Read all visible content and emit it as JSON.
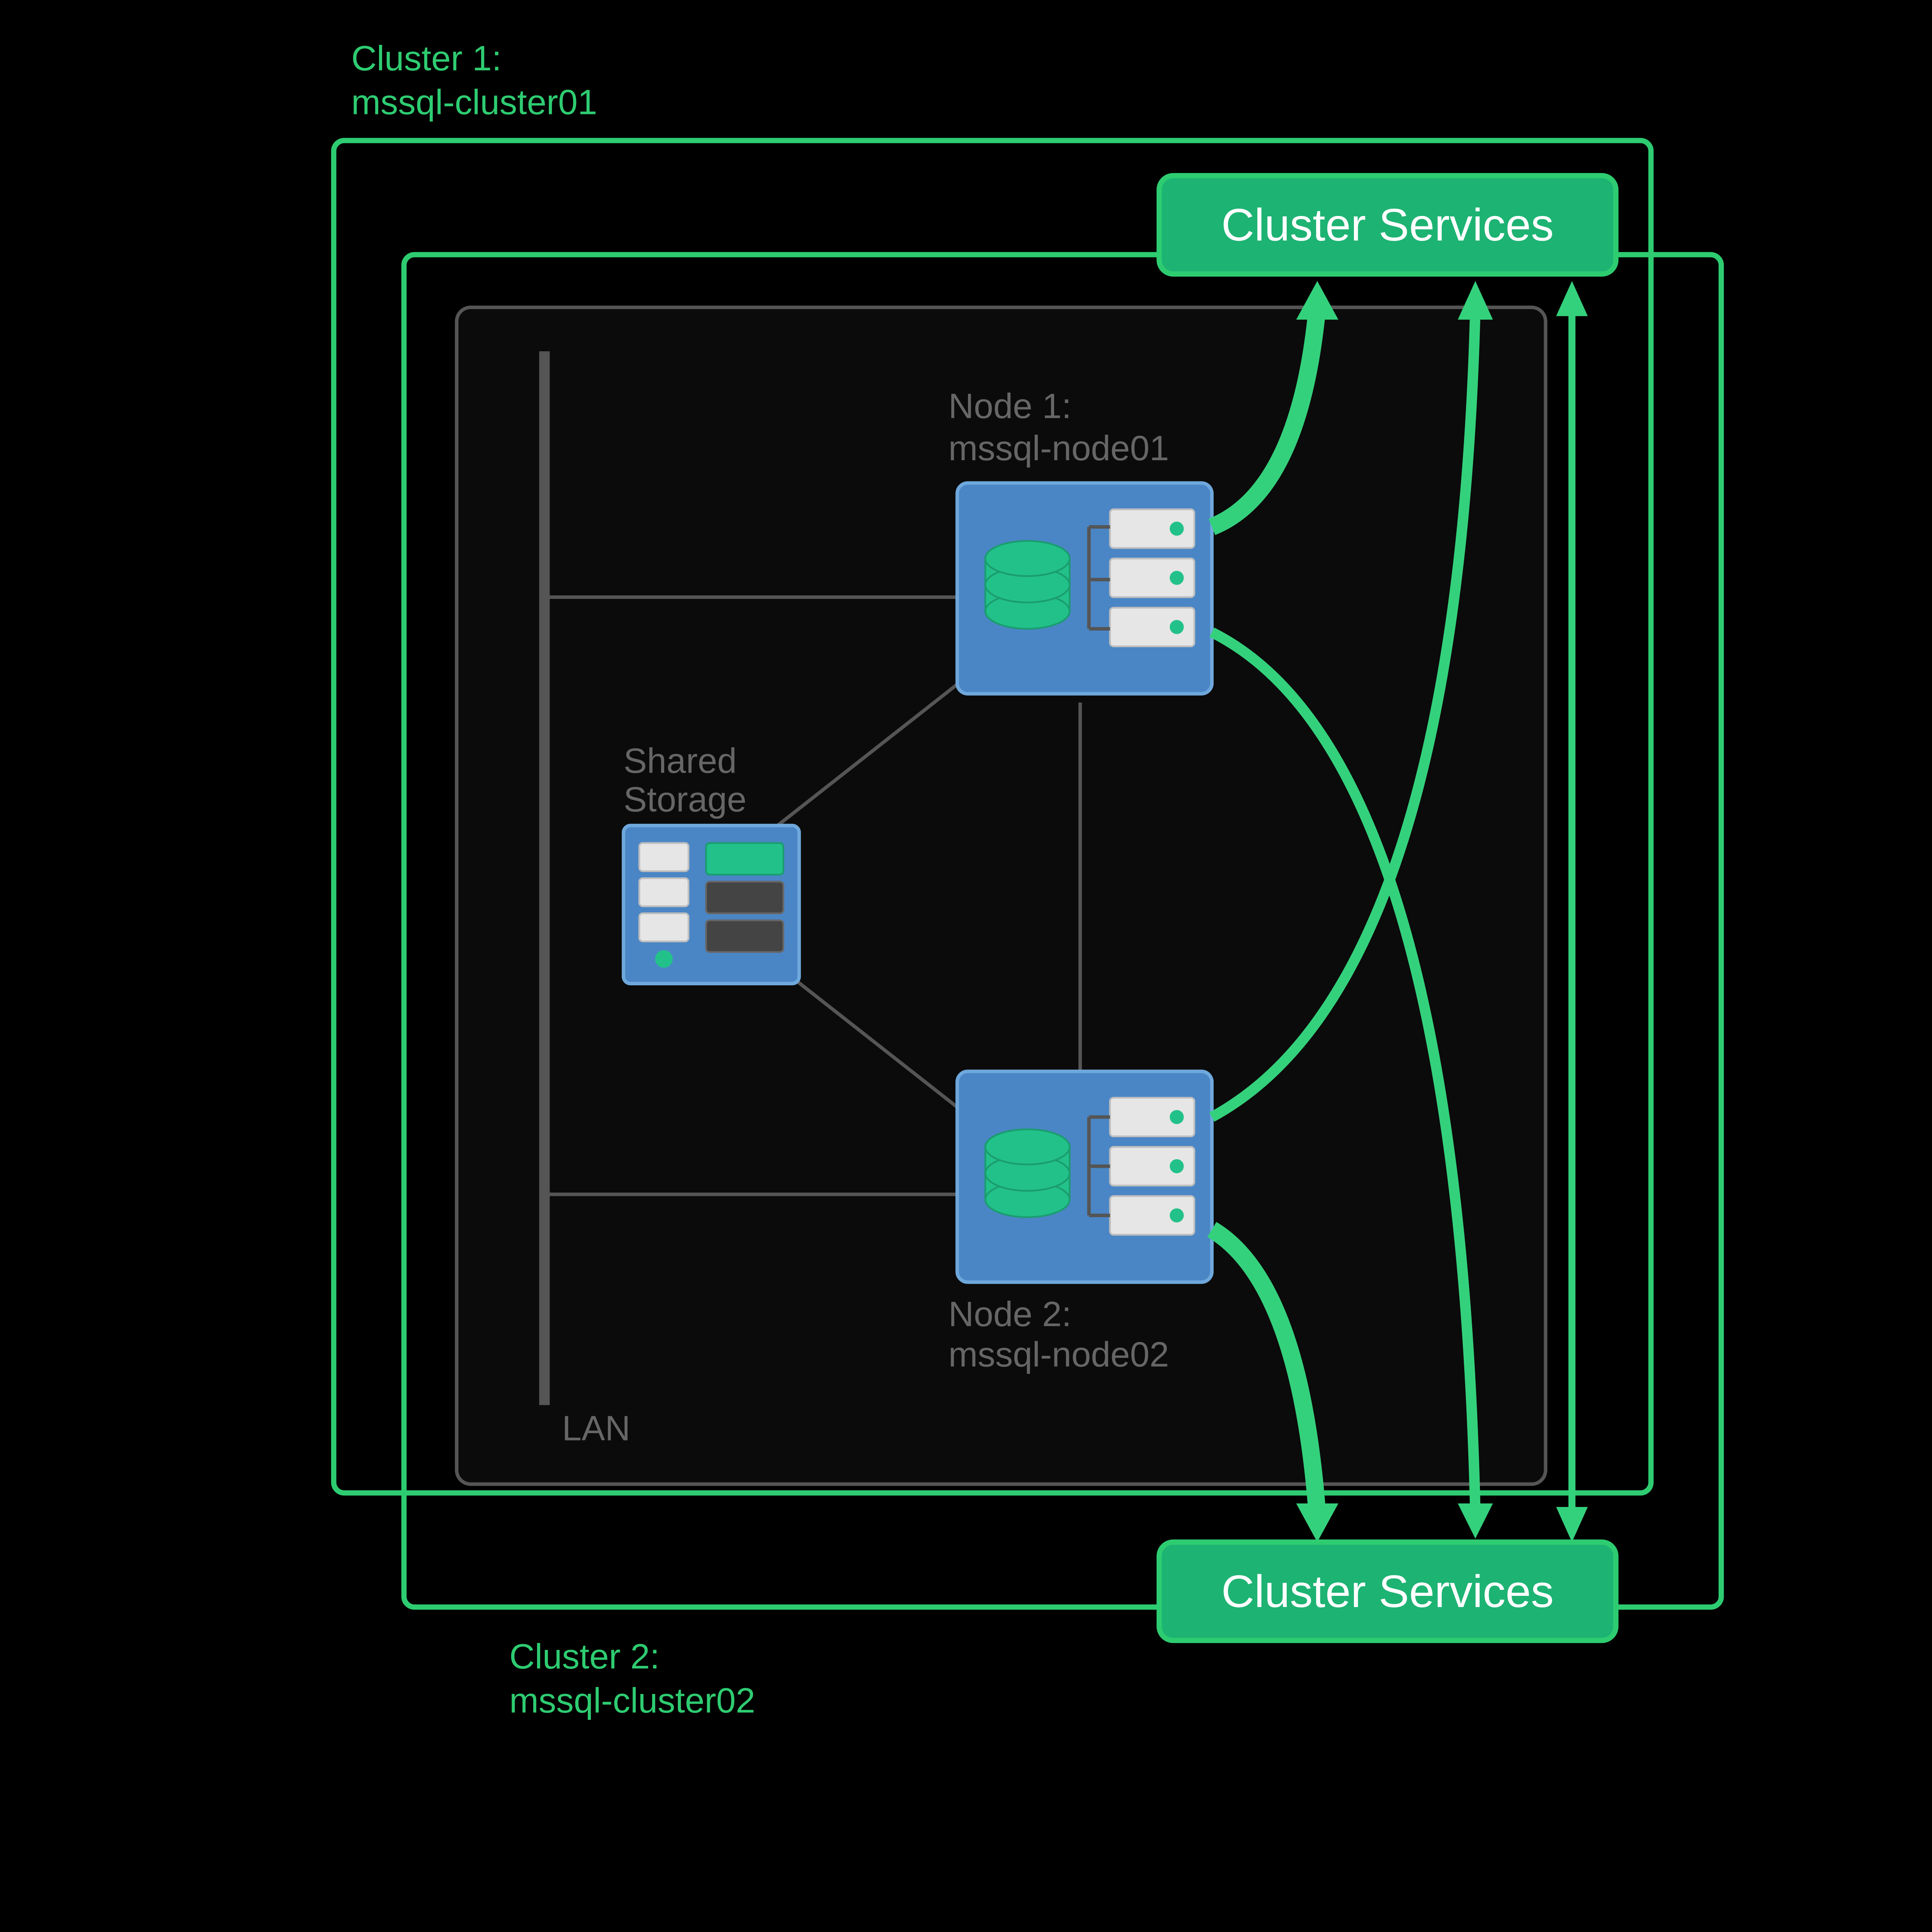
{
  "diagram": {
    "cluster1_label_line1": "Cluster 1:",
    "cluster1_label_line2": "mssql-cluster01",
    "cluster2_label_line1": "Cluster 2:",
    "cluster2_label_line2": "mssql-cluster02",
    "cluster_services_label_top": "Cluster Services",
    "cluster_services_label_bottom": "Cluster Services",
    "node1_label_line1": "Node 1:",
    "node1_label_line2": "mssql-node01",
    "node2_label_line1": "Node 2:",
    "node2_label_line2": "mssql-node02",
    "shared_storage_label_line1": "Shared",
    "shared_storage_label_line2": "Storage",
    "lan_label": "LAN",
    "colors": {
      "accent_green": "#2ecc71",
      "flow_green": "#34d17c",
      "service_fill": "#1db373",
      "node_blue": "#4a86c5",
      "gray": "#555"
    }
  }
}
